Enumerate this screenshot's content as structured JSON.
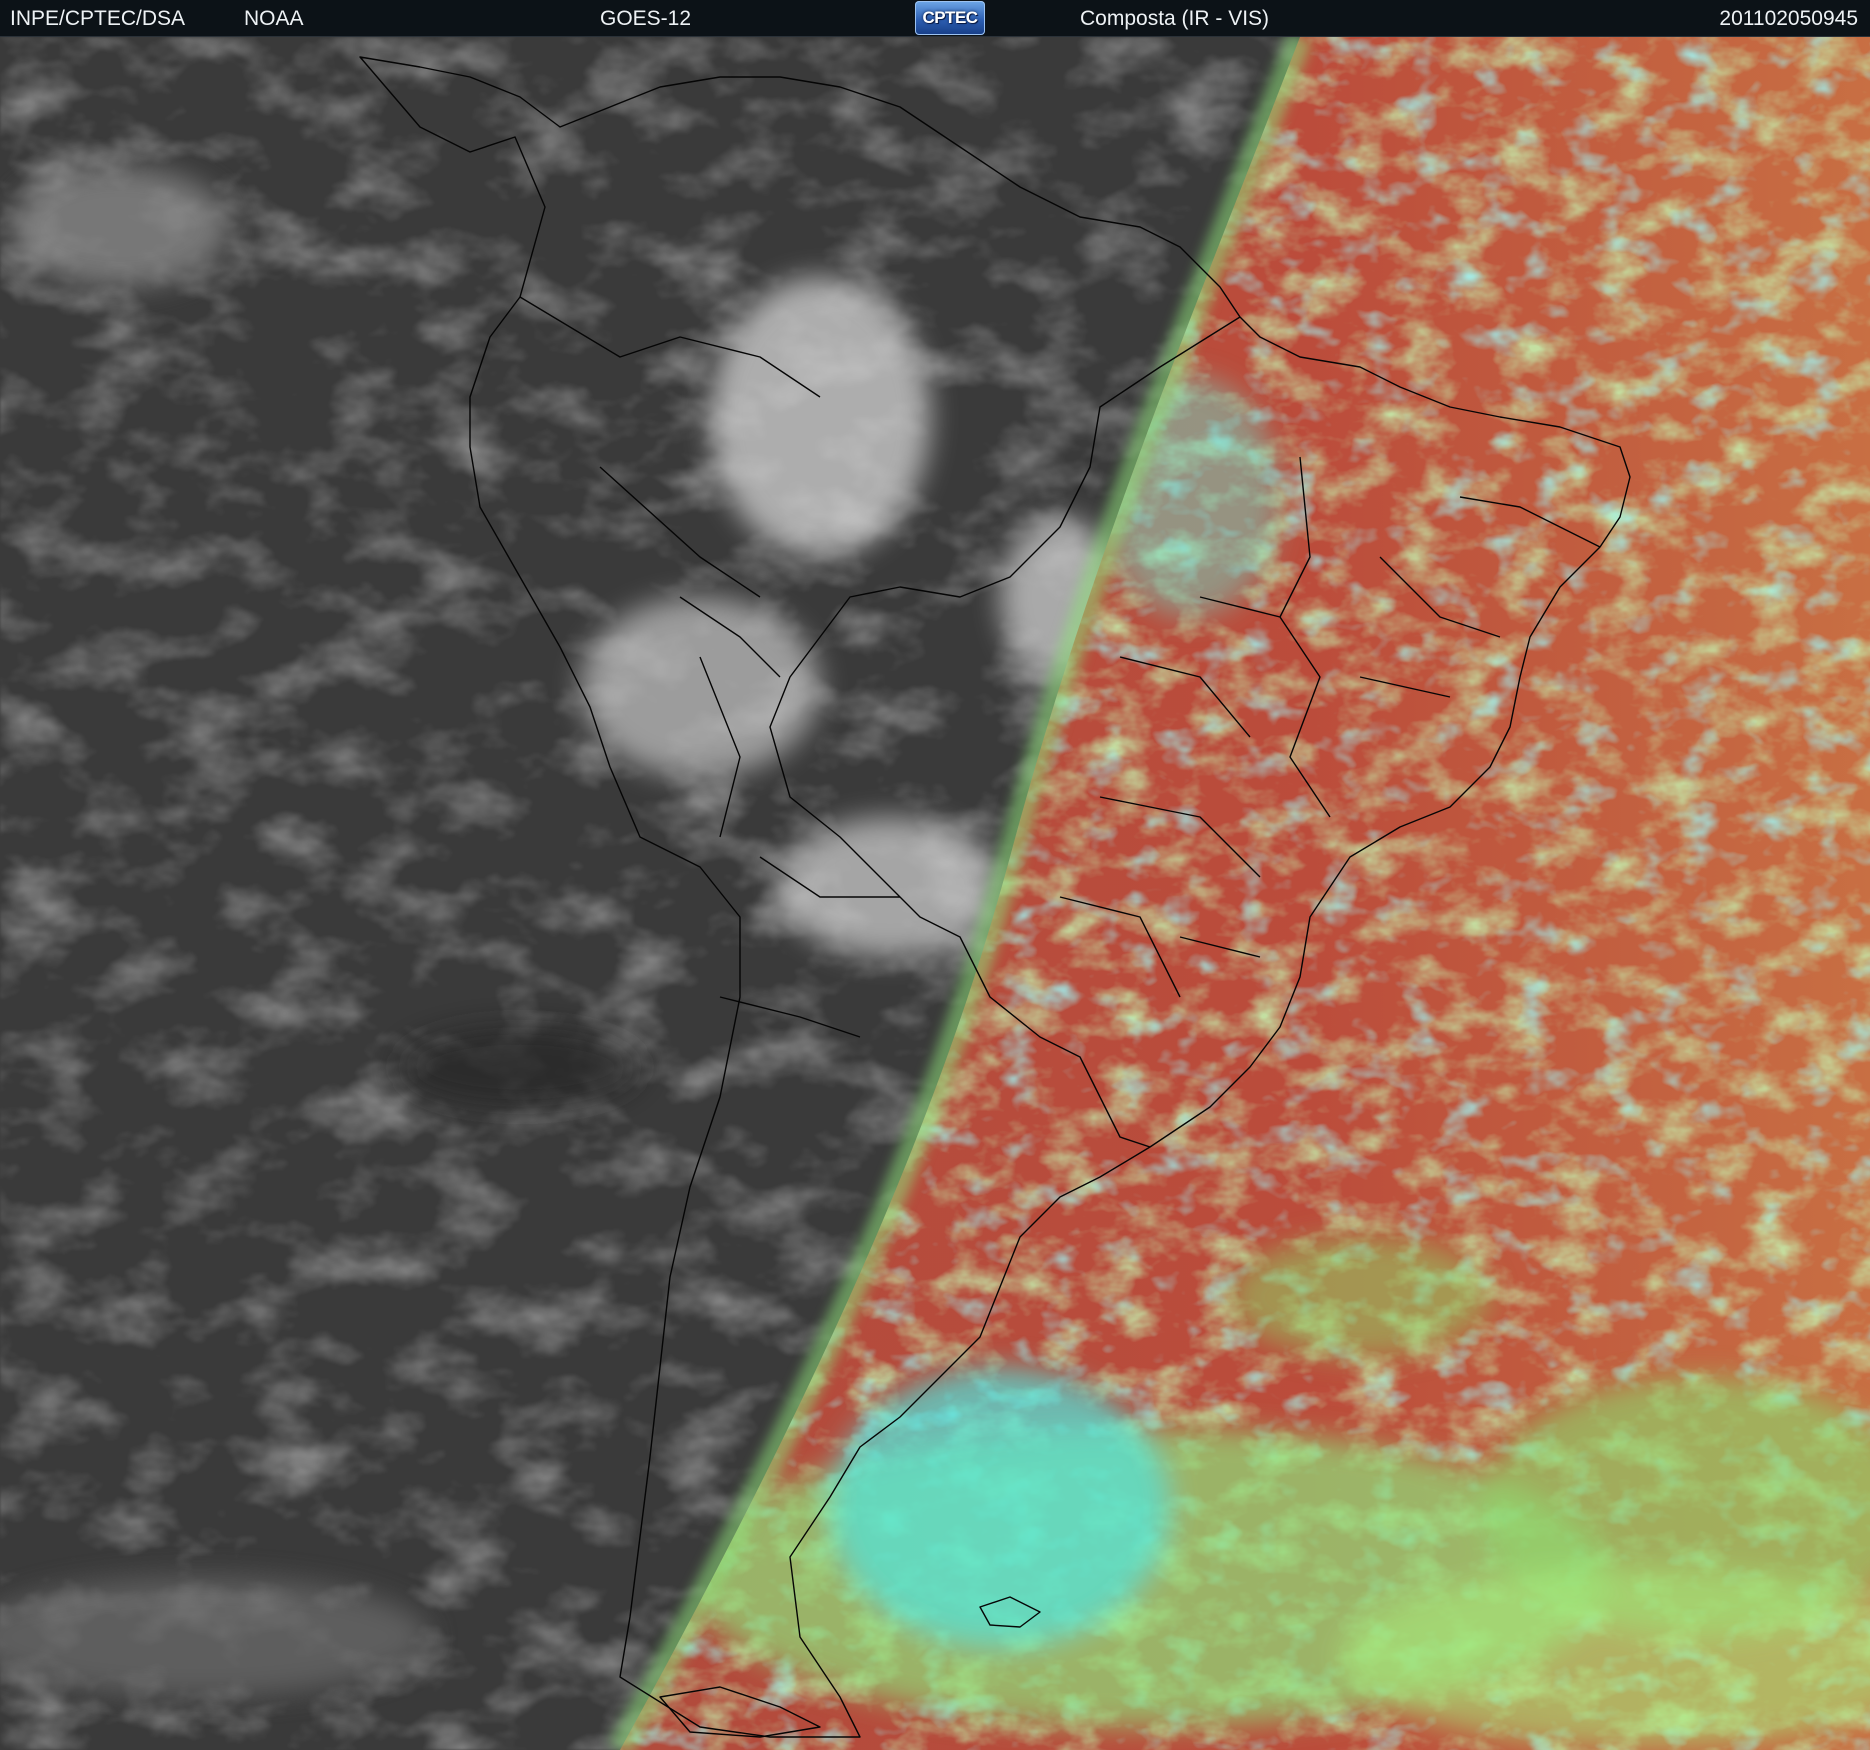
{
  "header": {
    "agency": "INPE/CPTEC/DSA",
    "partner": "NOAA",
    "satellite": "GOES-12",
    "logo_text": "CPTEC",
    "product": "Composta (IR - VIS)",
    "timestamp": "201102050945"
  },
  "colors": {
    "header_bg": "#0c1217",
    "header_text": "#eef2f5",
    "night_side": "#3a3a3a",
    "day_side_ground": "#b94c3c",
    "day_side_low_cloud": "#8fd36a",
    "day_side_high_cloud": "#45e3e3",
    "coastline": "#000000"
  },
  "image_content": {
    "left_half": "infrared grayscale (night side)",
    "right_half": "false-color visible composite (day side)",
    "overlay": "country and state borders"
  }
}
